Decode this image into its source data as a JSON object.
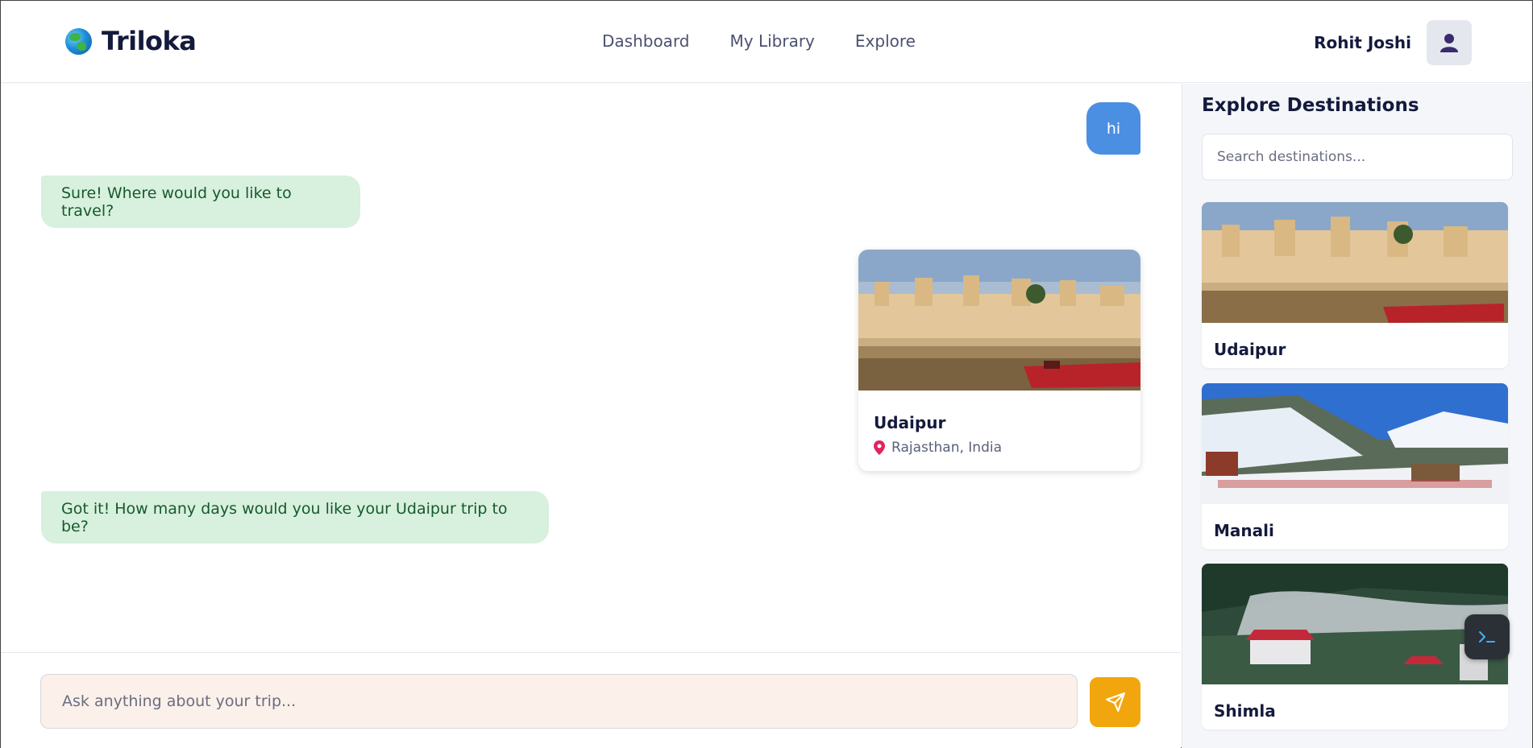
{
  "header": {
    "brand": "Triloka",
    "nav": [
      "Dashboard",
      "My Library",
      "Explore"
    ],
    "user_name": "Rohit Joshi"
  },
  "chat": {
    "messages": [
      {
        "role": "user",
        "text": "hi"
      },
      {
        "role": "assistant",
        "text": "Sure! Where would you like to travel?"
      },
      {
        "role": "card",
        "title": "Udaipur",
        "location": "Rajasthan, India"
      },
      {
        "role": "assistant",
        "text": "Got it! How many days would you like your Udaipur trip to be?"
      }
    ],
    "input_placeholder": "Ask anything about your trip..."
  },
  "sidebar": {
    "title": "Explore Destinations",
    "search_placeholder": "Search destinations...",
    "destinations": [
      "Udaipur",
      "Manali",
      "Shimla"
    ]
  },
  "icons": {
    "logo": "globe-icon",
    "avatar": "user-icon",
    "send": "send-icon",
    "location": "map-pin-icon",
    "terminal": "terminal-icon"
  },
  "colors": {
    "user_bubble": "#4a8fe2",
    "assistant_bubble": "#d8f0de",
    "send_button": "#f2a60d",
    "brand_text": "#141a3c"
  }
}
